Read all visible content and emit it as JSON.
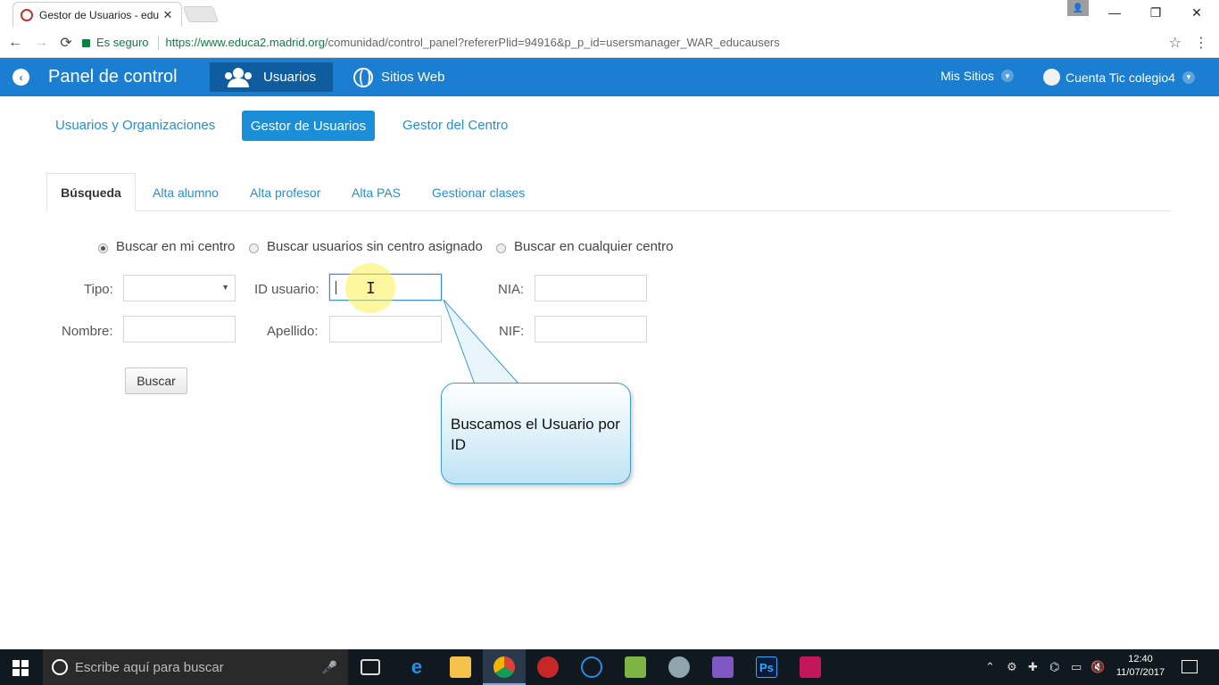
{
  "browser": {
    "tab_title": "Gestor de Usuarios - edu",
    "tab_close": "✕",
    "window_buttons": {
      "minimize": "—",
      "restore": "❐",
      "close": "✕"
    },
    "secure_label": "Es seguro",
    "url_scheme_host": "https://www.educa2.madrid.org",
    "url_path": "/comunidad/control_panel?refererPlid=94916&p_p_id=usersmanager_WAR_educausers",
    "back": "←",
    "forward": "→",
    "reload": "⟳",
    "star": "☆",
    "menu": "⋮",
    "profile": "👤"
  },
  "appbar": {
    "back_glyph": "‹",
    "title": "Panel de control",
    "nav_users": "Usuarios",
    "nav_sites": "Sitios Web",
    "mis_sitios": "Mis Sitios",
    "account": "Cuenta Tic colegio4",
    "caret": "▼"
  },
  "subnav": {
    "items": [
      "Usuarios y Organizaciones",
      "Gestor de Usuarios",
      "Gestor del Centro"
    ],
    "active": "Gestor de Usuarios"
  },
  "tabs": {
    "items": [
      "Búsqueda",
      "Alta alumno",
      "Alta profesor",
      "Alta PAS",
      "Gestionar clases"
    ],
    "active": "Búsqueda"
  },
  "search_scope": {
    "options": [
      "Buscar en mi centro",
      "Buscar usuarios sin centro asignado",
      "Buscar en cualquier centro"
    ],
    "selected": "Buscar en mi centro"
  },
  "form": {
    "tipo_label": "Tipo:",
    "tipo_value": "",
    "select_arrow": "▼",
    "id_label": "ID usuario:",
    "id_value": "",
    "nia_label": "NIA:",
    "nia_value": "",
    "nombre_label": "Nombre:",
    "nombre_value": "",
    "apellido_label": "Apellido:",
    "apellido_value": "",
    "nif_label": "NIF:",
    "nif_value": "",
    "submit": "Buscar"
  },
  "callout": {
    "text": "Buscamos el Usuario por ID"
  },
  "cursor": {
    "glyph": "I"
  },
  "taskbar": {
    "search_placeholder": "Escribe aquí para buscar",
    "mic": "🎤",
    "time": "12:40",
    "date": "11/07/2017",
    "tray_up": "⌃",
    "tray_items": [
      "⚙",
      "✚",
      "⌬",
      "▭",
      "🔇"
    ]
  },
  "colors": {
    "appbar": "#1b7ed0",
    "accent": "#1b8ed8",
    "link": "#2a8dcf",
    "taskbar": "#101820"
  }
}
